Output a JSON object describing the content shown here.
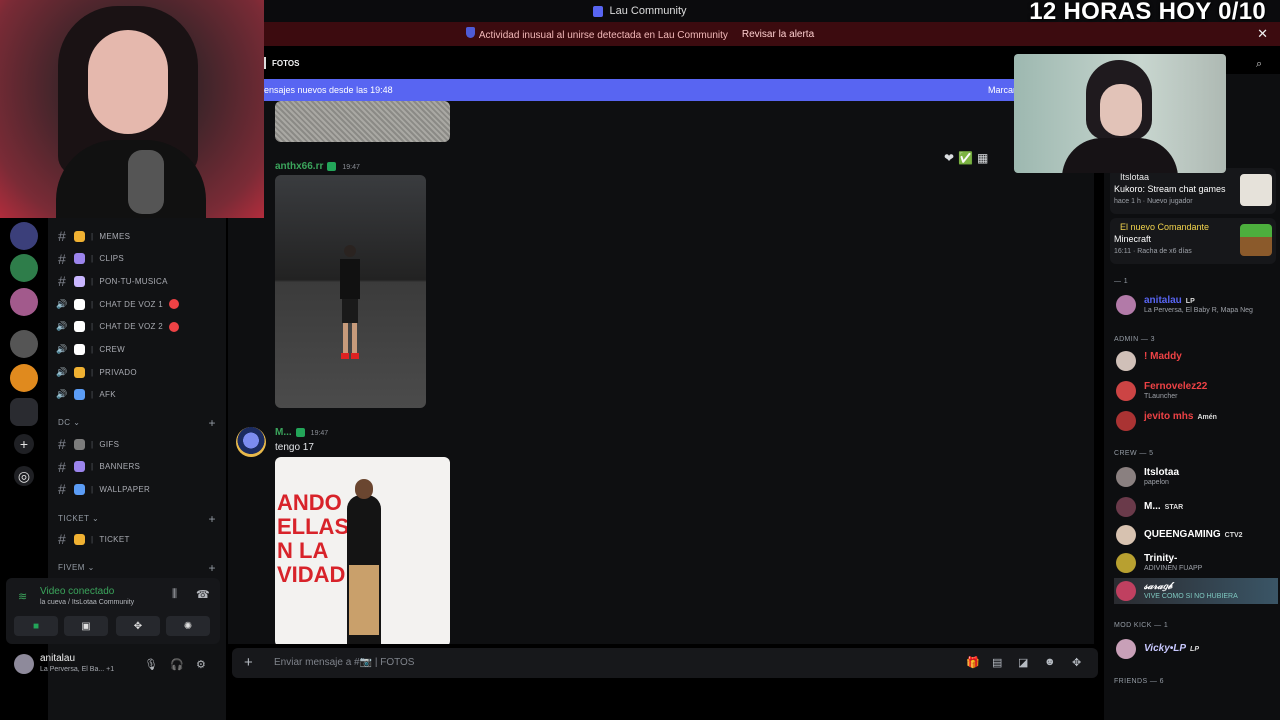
{
  "window": {
    "title": "Lau Community"
  },
  "overlay": {
    "stream_text": "12 HORAS HOY 0/10"
  },
  "alert": {
    "text": "Actividad inusual al unirse detectada en Lau Community",
    "action": "Revisar la alerta"
  },
  "channels": [
    {
      "label": "MEMES",
      "emoji_color": "#f0b132",
      "type": "text"
    },
    {
      "label": "CLIPS",
      "emoji_color": "#9b84ec",
      "type": "text"
    },
    {
      "label": "PON-TU-MUSICA",
      "emoji_color": "#c9b6ff",
      "type": "text"
    },
    {
      "label": "CHAT DE VOZ 1",
      "emoji_color": "#ffffff",
      "type": "voice"
    },
    {
      "label": "CHAT DE VOZ 2",
      "emoji_color": "#ffffff",
      "type": "voice"
    },
    {
      "label": "CREW",
      "emoji_color": "#ffffff",
      "type": "voice"
    },
    {
      "label": "PRIVADO",
      "emoji_color": "#f0b132",
      "type": "voice"
    },
    {
      "label": "AFK",
      "emoji_color": "#5b9cf5",
      "type": "voice"
    }
  ],
  "categories": {
    "dc": "DC",
    "dc_channels": [
      {
        "label": "GIFS"
      },
      {
        "label": "BANNERS"
      },
      {
        "label": "WALLPAPER"
      }
    ],
    "ticket": "TICKET",
    "ticket_channels": [
      {
        "label": "TICKET"
      }
    ],
    "fivem": "FIVEM"
  },
  "voice": {
    "status": "Video conectado",
    "location": "la cueva / ItsLotaa Community"
  },
  "user": {
    "name": "anitalau",
    "status": "La Perversa, El Ba...",
    "extra": "+1"
  },
  "chat": {
    "channel_name": "FOTOS",
    "new_messages": "ensajes nuevos desde las 19:48",
    "mark_read": "Marcar",
    "messages": [
      {
        "author": "anthx66.rr",
        "time": "19:47",
        "color": "#3ba55c"
      },
      {
        "author": "M...",
        "time": "19:47",
        "color": "#3ba55c",
        "text": "tengo 17"
      }
    ],
    "composer_placeholder": "Enviar mensaje a #📷 | FOTOS",
    "photo_text": [
      "ANDO",
      "ELLAS",
      "N LA",
      "VIDAD"
    ]
  },
  "activities": [
    {
      "user": "Itslotaa",
      "game": "Kukoro: Stream chat games",
      "meta1": "hace 1 h",
      "meta2": "Nuevo jugador"
    },
    {
      "user": "El nuevo Comandante",
      "game": "Minecraft",
      "meta1": "16:11",
      "meta2": "Racha de x6 días"
    }
  ],
  "member_groups": [
    {
      "label": "— 1"
    },
    {
      "label": "ADMIN — 3"
    },
    {
      "label": "CREW — 5"
    },
    {
      "label": "MOD KICK — 1"
    },
    {
      "label": "FRIENDS — 6"
    }
  ],
  "members": [
    {
      "name": "anitalau",
      "status": "La Perversa, El Baby R, Mapa Neg",
      "color": "#5865f2",
      "tag": "LP"
    },
    {
      "name": "! Maddy",
      "status": "",
      "color": "#ed4245",
      "tag": ""
    },
    {
      "name": "Fernovelez22",
      "status": "TLauncher",
      "color": "#ed4245",
      "tag": ""
    },
    {
      "name": "jevito mhs",
      "status": "",
      "color": "#ed4245",
      "tag": "Amén"
    },
    {
      "name": "Itslotaa",
      "status": "papelon",
      "color": "#ffffff",
      "tag": ""
    },
    {
      "name": "M...",
      "status": "",
      "color": "#ffffff",
      "tag": "STAR"
    },
    {
      "name": "QUEENGAMING",
      "status": "",
      "color": "#ffffff",
      "tag": "CTV2"
    },
    {
      "name": "Trinity-",
      "status": "ADIVINEN FUAPP",
      "color": "#ffffff",
      "tag": ""
    },
    {
      "name": "𝓈𝒶𝓇𝒶𝑔𝒷",
      "status": "VIVE COMO SI NO HUBIERA",
      "color": "#ffffff",
      "tag": ""
    },
    {
      "name": "Vicky•LP",
      "status": "",
      "color": "#c8c8ff",
      "tag": "LP"
    }
  ]
}
